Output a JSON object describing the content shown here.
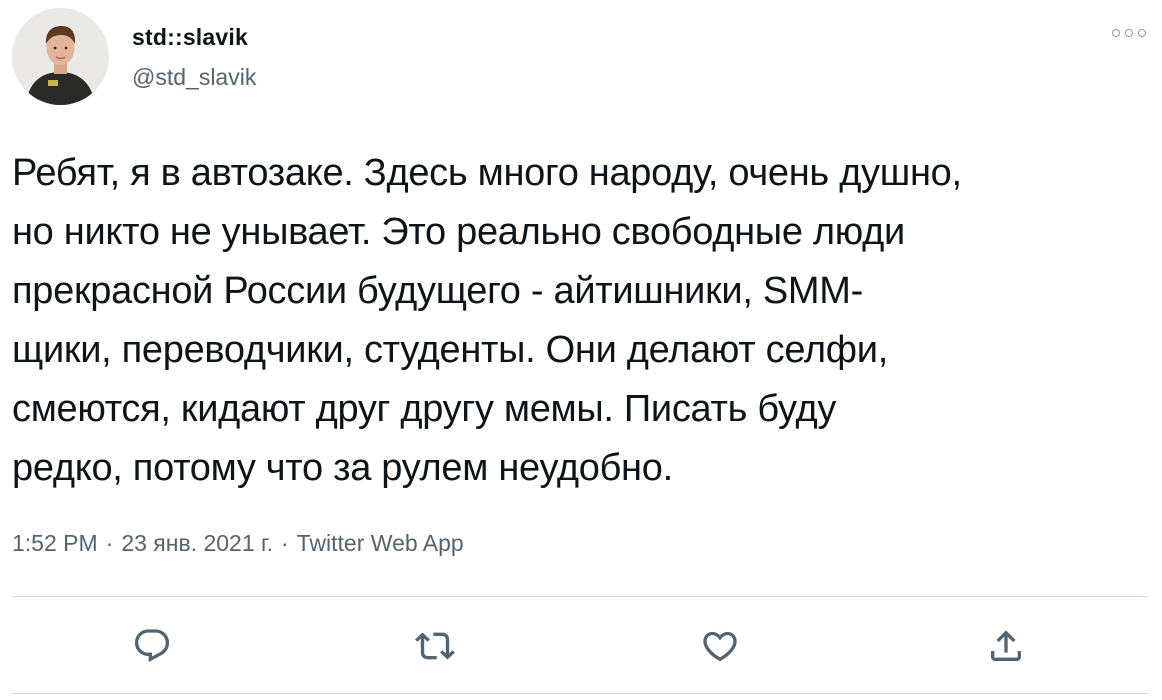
{
  "author": {
    "display_name": "std::slavik",
    "handle": "@std_slavik"
  },
  "tweet": {
    "lines": [
      "Ребят, я в автозаке. Здесь много народу, очень душно,",
      "но никто не унывает. Это реально свободные люди",
      "прекрасной России будущего - айтишники, SMM-",
      "щики, переводчики, студенты. Они делают селфи,",
      "смеются, кидают друг другу мемы. Писать буду",
      "редко, потому что за рулем неудобно."
    ]
  },
  "meta": {
    "time": "1:52 PM",
    "separator": "·",
    "date": "23 янв. 2021 г.",
    "source": "Twitter Web App"
  },
  "icons": {
    "more": "more-horizontal-icon",
    "reply": "reply-icon",
    "retweet": "retweet-icon",
    "like": "heart-icon",
    "share": "share-icon"
  },
  "colors": {
    "text": "#0f1419",
    "secondary": "#536471",
    "icon": "#536471",
    "divider": "#cfd9de"
  }
}
